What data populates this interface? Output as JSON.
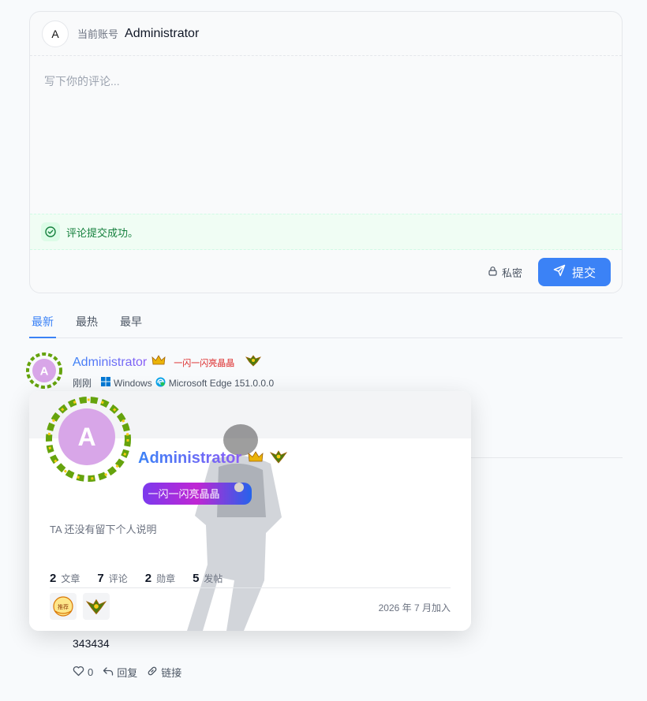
{
  "editor": {
    "avatar_initial": "A",
    "account_label": "当前账号",
    "account_name": "Administrator",
    "placeholder": "写下你的评论...",
    "success_message": "评论提交成功。",
    "private_label": "私密",
    "submit_label": "提交"
  },
  "tabs": [
    "最新",
    "最热",
    "最早"
  ],
  "comment": {
    "author": "Administrator",
    "title_badge": "一闪一闪亮晶晶",
    "avatar_initial": "A",
    "time": "刚刚",
    "os": "Windows",
    "browser": "Microsoft Edge 151.0.0.0",
    "content": "343434",
    "likes": "0",
    "reply_label": "回复",
    "link_label": "链接"
  },
  "profile_card": {
    "avatar_initial": "A",
    "name": "Administrator",
    "banner_text": "一闪一闪亮晶晶",
    "description": "TA 还没有留下个人说明",
    "stats": [
      {
        "num": "2",
        "label": "文章"
      },
      {
        "num": "7",
        "label": "评论"
      },
      {
        "num": "2",
        "label": "勋章"
      },
      {
        "num": "5",
        "label": "发帖"
      }
    ],
    "medal_1_text": "推荐",
    "joined": "2026 年 7 月加入"
  },
  "colors": {
    "accent": "#3b82f6",
    "success": "#15803d",
    "success_bg": "#f0fdf4",
    "name_gradient_start": "#3b82f6",
    "name_gradient_end": "#8b5cf6",
    "title_red": "#dc2626"
  }
}
